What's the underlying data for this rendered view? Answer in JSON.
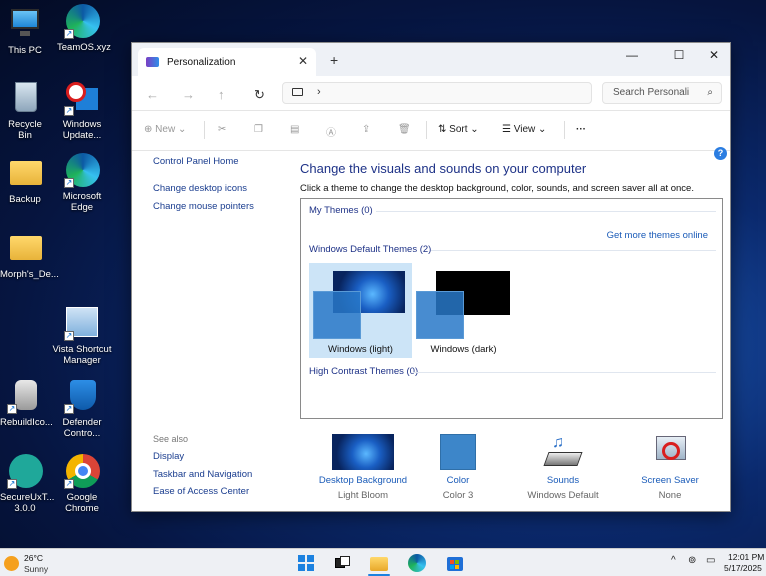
{
  "desktop": {
    "icons": [
      {
        "label": "This PC"
      },
      {
        "label": "TeamOS.xyz"
      },
      {
        "label": "Recycle Bin"
      },
      {
        "label": "Windows Update..."
      },
      {
        "label": "Backup"
      },
      {
        "label": "Microsoft Edge"
      },
      {
        "label": "Morph's_De..."
      },
      {
        "label": "Vista Shortcut Manager"
      },
      {
        "label": "RebuildIco..."
      },
      {
        "label": "Defender Contro..."
      },
      {
        "label": "SecureUxT... 3.0.0"
      },
      {
        "label": "Google Chrome"
      }
    ]
  },
  "window": {
    "tab_title": "Personalization",
    "search_placeholder": "Search Personali",
    "toolbar": {
      "new_label": "New",
      "sort_label": "Sort",
      "view_label": "View",
      "more_label": "···"
    },
    "left_pane": {
      "links": [
        "Control Panel Home",
        "Change desktop icons",
        "Change mouse pointers"
      ],
      "see_also_label": "See also",
      "see_also_links": [
        "Display",
        "Taskbar and Navigation",
        "Ease of Access Center"
      ]
    },
    "main": {
      "heading": "Change the visuals and sounds on your computer",
      "description": "Click a theme to change the desktop background, color, sounds, and screen saver all at once.",
      "my_themes": "My Themes (0)",
      "get_more_link": "Get more themes online",
      "default_themes": "Windows Default Themes (2)",
      "themes": [
        {
          "label": "Windows (light)",
          "selected": true
        },
        {
          "label": "Windows (dark)",
          "selected": false
        }
      ],
      "high_contrast": "High Contrast Themes (0)"
    },
    "bottom": [
      {
        "label": "Desktop Background",
        "value": "Light Bloom"
      },
      {
        "label": "Color",
        "value": "Color 3"
      },
      {
        "label": "Sounds",
        "value": "Windows Default"
      },
      {
        "label": "Screen Saver",
        "value": "None"
      }
    ]
  },
  "taskbar": {
    "weather_temp": "26°C",
    "weather_desc": "Sunny",
    "time": "12:01 PM",
    "date": "5/17/2025"
  }
}
